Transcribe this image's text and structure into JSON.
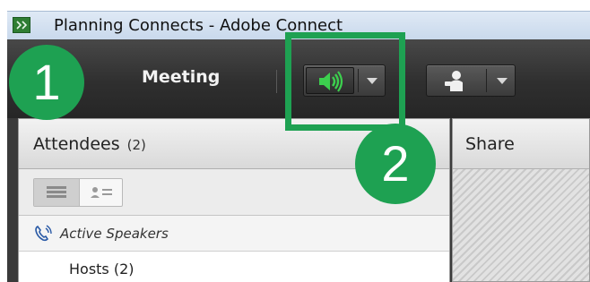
{
  "window": {
    "title": "Planning Connects - Adobe Connect",
    "app_icon_glyph": "⌘"
  },
  "menubar": {
    "meeting_label": "Meeting"
  },
  "toolbar": {
    "audio_button": {
      "icon": "speaker-icon",
      "state": "active",
      "color": "#34c759"
    },
    "camera_button": {
      "icon": "camera-voip-icon"
    }
  },
  "annotations": {
    "step_one": "1",
    "step_two": "2",
    "color": "#1ea152"
  },
  "attendees_pod": {
    "title": "Attendees",
    "count": "(2)",
    "active_speakers_label": "Active Speakers",
    "host_label": "Hosts (2)"
  },
  "share_pod": {
    "title": "Share"
  }
}
